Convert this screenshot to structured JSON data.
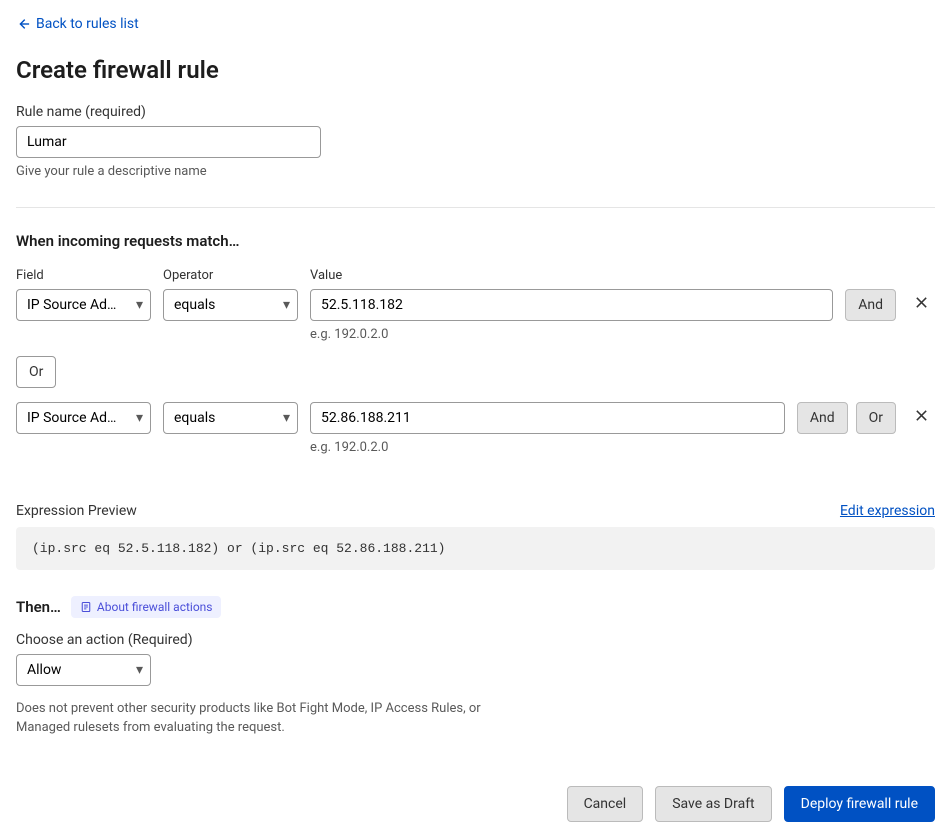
{
  "nav": {
    "back_label": "Back to rules list"
  },
  "page": {
    "title": "Create firewall rule"
  },
  "rule_name": {
    "label": "Rule name (required)",
    "value": "Lumar",
    "helper": "Give your rule a descriptive name"
  },
  "match": {
    "heading": "When incoming requests match…",
    "headers": {
      "field": "Field",
      "operator": "Operator",
      "value": "Value"
    },
    "rows": [
      {
        "field": "IP Source Add…",
        "operator": "equals",
        "value": "52.5.118.182",
        "example": "e.g. 192.0.2.0",
        "and_label": "And",
        "or_label": "Or",
        "show_or": false
      },
      {
        "field": "IP Source Add…",
        "operator": "equals",
        "value": "52.86.188.211",
        "example": "e.g. 192.0.2.0",
        "and_label": "And",
        "or_label": "Or",
        "show_or": true
      }
    ],
    "or_divider": "Or"
  },
  "expression": {
    "label": "Expression Preview",
    "edit_link": "Edit expression",
    "preview": "(ip.src eq 52.5.118.182) or (ip.src eq 52.86.188.211)"
  },
  "then": {
    "heading": "Then…",
    "about_label": "About firewall actions",
    "choose_label": "Choose an action (Required)",
    "action": "Allow",
    "description": "Does not prevent other security products like Bot Fight Mode, IP Access Rules, or Managed rulesets from evaluating the request."
  },
  "footer": {
    "cancel": "Cancel",
    "save_draft": "Save as Draft",
    "deploy": "Deploy firewall rule"
  }
}
